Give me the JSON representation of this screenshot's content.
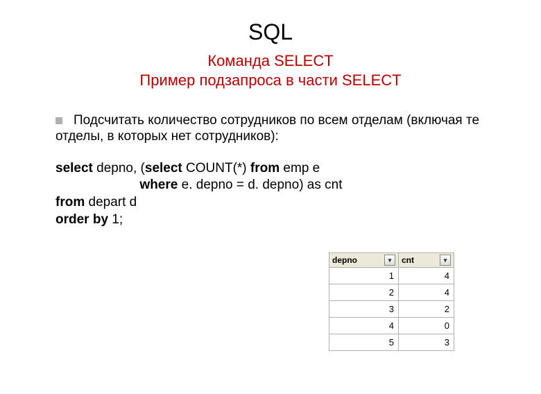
{
  "title": "SQL",
  "subtitle1": "Команда SELECT",
  "subtitle2": "Пример подзапроса в части SELECT",
  "paragraph": {
    "line1": "Подсчитать количество сотрудников по всем отделам (включая те",
    "line2": "отделы, в которых нет сотрудников):"
  },
  "code": {
    "kw_select": "select",
    "l1_rest": " depno, (",
    "kw_select2": "select",
    "l1_rest2": " COUNT(*) ",
    "kw_from": "from",
    "l1_rest3": " emp e",
    "l2_indent": "                       ",
    "kw_where": "where",
    "l2_rest": " e. depno = d. depno) as cnt",
    "kw_from2": "from",
    "l3_rest": " depart d",
    "kw_orderby": "order by",
    "l4_rest": " 1;"
  },
  "chart_data": {
    "type": "table",
    "columns": [
      "depno",
      "cnt"
    ],
    "rows": [
      {
        "depno": 1,
        "cnt": 4
      },
      {
        "depno": 2,
        "cnt": 4
      },
      {
        "depno": 3,
        "cnt": 2
      },
      {
        "depno": 4,
        "cnt": 0
      },
      {
        "depno": 5,
        "cnt": 3
      }
    ]
  },
  "icons": {
    "dropdown": "▾"
  }
}
